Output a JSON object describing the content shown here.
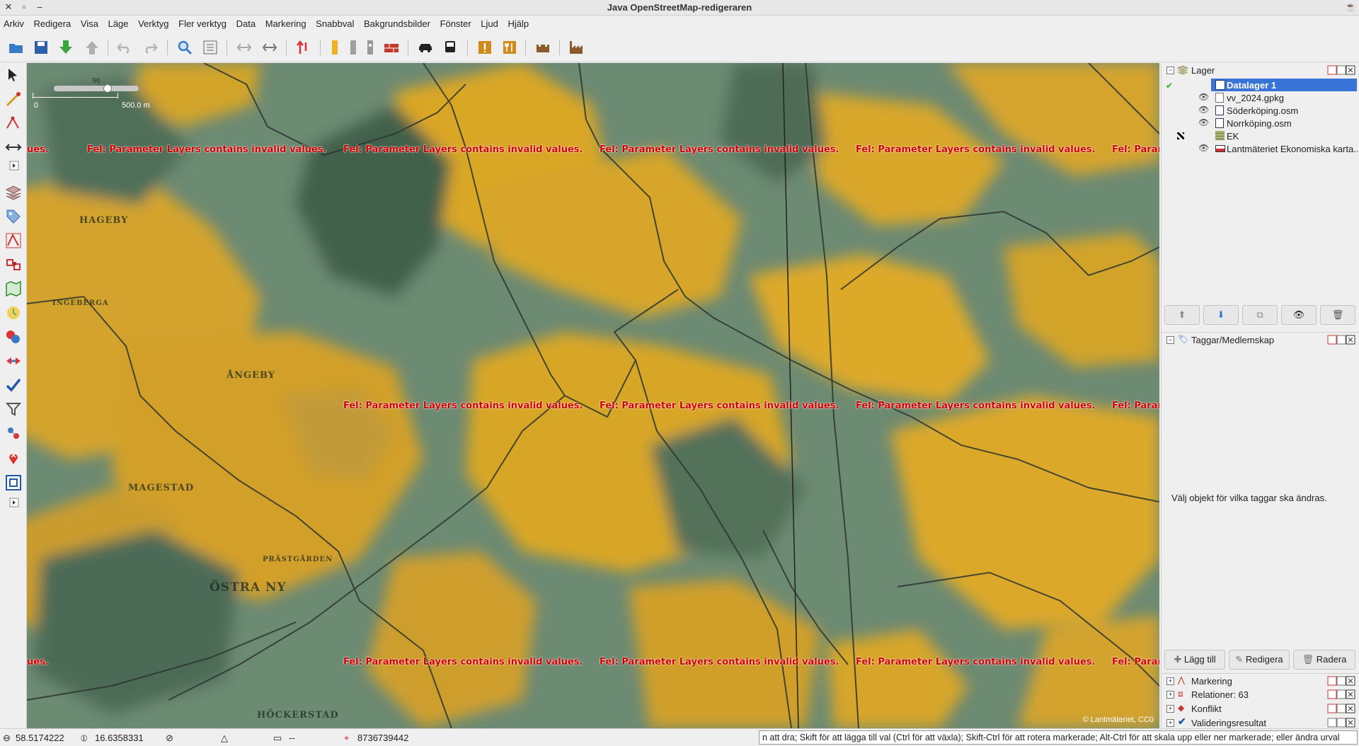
{
  "window": {
    "title": "Java OpenStreetMap-redigeraren"
  },
  "menu": [
    "Arkiv",
    "Redigera",
    "Visa",
    "Läge",
    "Verktyg",
    "Fler verktyg",
    "Data",
    "Markering",
    "Snabbval",
    "Bakgrundsbilder",
    "Fönster",
    "Ljud",
    "Hjälp"
  ],
  "map": {
    "error_text": "Fel: Parameter Layers contains invalid values.",
    "error_text_left": "ues.",
    "error_text_right": "Fel: Param",
    "scale": {
      "zero": "0",
      "distance": "500.0 m",
      "zoom": "96"
    },
    "attribution": "© Lantmäteriet, CC0",
    "places": [
      "HAGEBY",
      "ÅNGEBY",
      "MAGESTAD",
      "ÖSTRA NY",
      "HÖCKERSTAD",
      "PRÄSTGÅRDEN",
      "INGEBERGA"
    ]
  },
  "layers_panel": {
    "title": "Lager",
    "layers": [
      {
        "name": "Datalager 1",
        "active": true
      },
      {
        "name": "vv_2024.gpkg"
      },
      {
        "name": "Söderköping.osm"
      },
      {
        "name": "Norrköping.osm"
      },
      {
        "name": "EK"
      },
      {
        "name": "Lantmäteriet Ekonomiska karta..."
      }
    ]
  },
  "tags_panel": {
    "title": "Taggar/Medlemskap",
    "empty_text": "Välj objekt för vilka taggar ska ändras.",
    "add_label": "Lägg till",
    "edit_label": "Redigera",
    "delete_label": "Radera"
  },
  "collapsed_panels": [
    "Markering",
    "Relationer: 63",
    "Konflikt",
    "Valideringsresultat"
  ],
  "status": {
    "lat": "58.5174222",
    "lon": "16.6358331",
    "heading": "",
    "angle": "",
    "length": "--",
    "id": "8736739442",
    "help": "n att dra; Skift för att lägga till val (Ctrl för att växla); Skift-Ctrl för att rotera markerade; Alt-Ctrl för att skala upp eller ner markerade; eller ändra urval"
  },
  "colors": {
    "accent": "#3874d8",
    "error": "#d20000",
    "field": "#e2a820",
    "forest": "#5e7f68"
  }
}
